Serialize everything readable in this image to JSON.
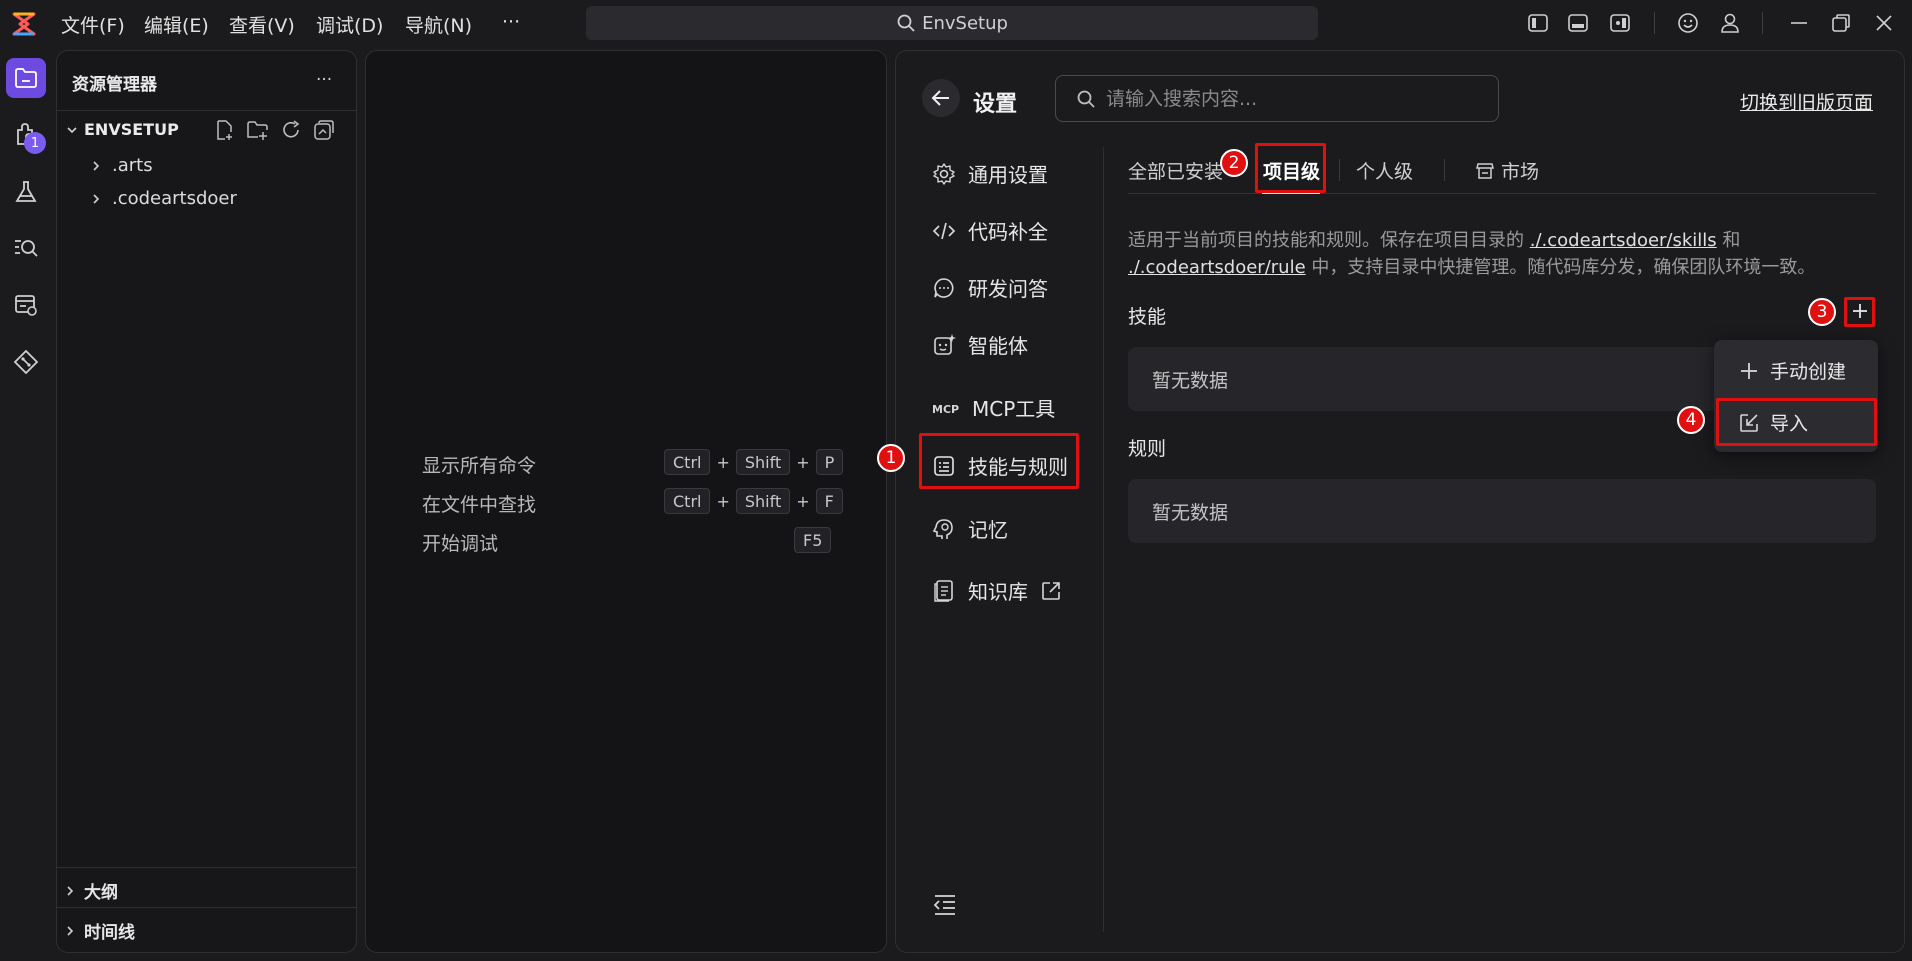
{
  "titlebar": {
    "menus": [
      "文件(F)",
      "编辑(E)",
      "查看(V)",
      "调试(D)",
      "导航(N)",
      "···"
    ],
    "command_center": "EnvSetup"
  },
  "activity": {
    "extensions_badge": "1"
  },
  "explorer": {
    "title": "资源管理器",
    "more": "···",
    "root": "ENVSETUP",
    "items": [
      ".arts",
      ".codeartsdoer"
    ],
    "sections": [
      "大纲",
      "时间线"
    ]
  },
  "welcome": {
    "shortcuts": [
      {
        "label": "显示所有命令",
        "keys": [
          "Ctrl",
          "Shift",
          "P"
        ]
      },
      {
        "label": "在文件中查找",
        "keys": [
          "Ctrl",
          "Shift",
          "F"
        ]
      },
      {
        "label": "开始调试",
        "keys": [
          "F5"
        ]
      }
    ],
    "plus": "+"
  },
  "settings": {
    "title": "设置",
    "search_placeholder": "请输入搜索内容...",
    "old_page_link": "切换到旧版页面",
    "nav": [
      "通用设置",
      "代码补全",
      "研发问答",
      "智能体",
      "MCP工具",
      "技能与规则",
      "记忆",
      "知识库"
    ],
    "tabs": [
      "全部已安装",
      "项目级",
      "个人级",
      "市场"
    ],
    "description": {
      "part1": "适用于当前项目的技能和规则。保存在项目目录的 ",
      "link1": "./.codeartsdoer/skills",
      "part2": " 和 ",
      "link2": "./.codeartsdoer/rule",
      "part3": " 中，支持目录中快捷管理。随代码库分发，确保团队环境一致。"
    },
    "skills_title": "技能",
    "rules_title": "规则",
    "empty_text": "暂无数据",
    "dropdown": [
      "手动创建",
      "导入"
    ]
  },
  "annotations": [
    "1",
    "2",
    "3",
    "4"
  ],
  "colors": {
    "accent": "#6d4be0",
    "annotation": "#e01010",
    "badge": "#7b5cf0"
  }
}
